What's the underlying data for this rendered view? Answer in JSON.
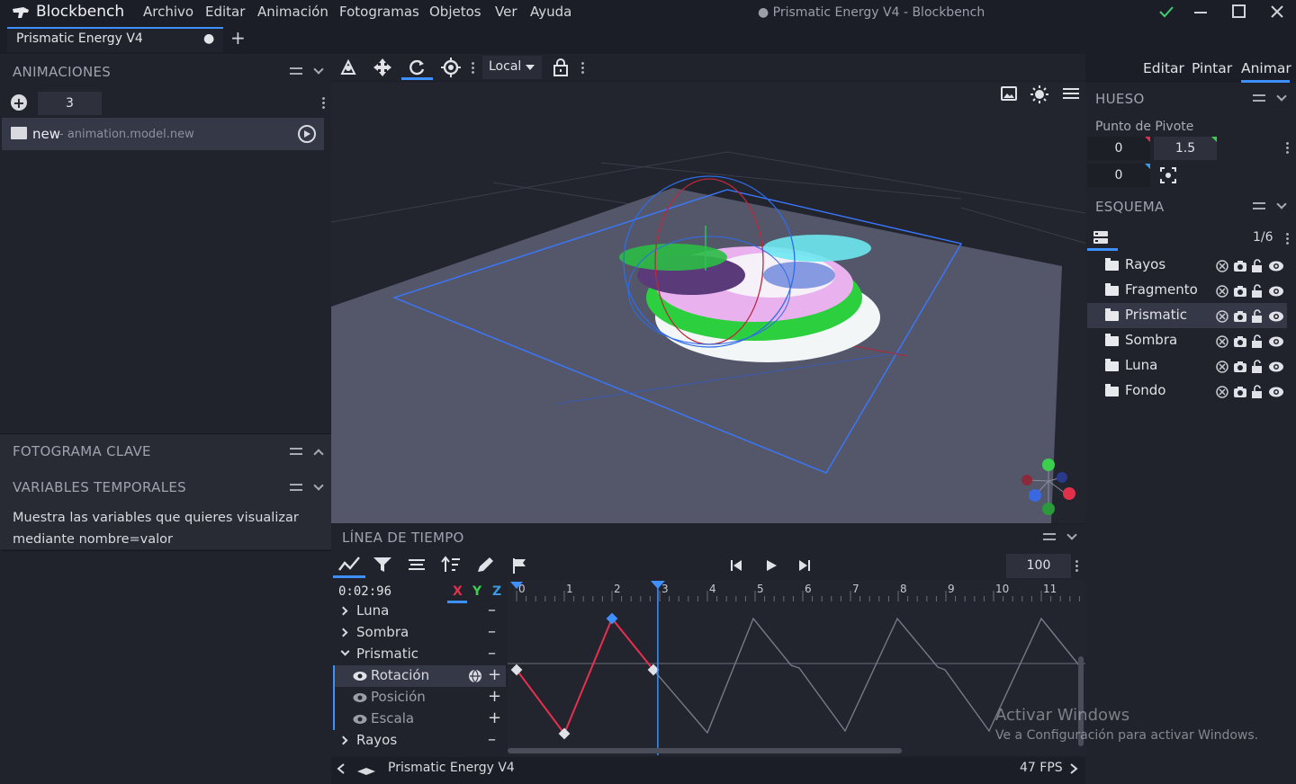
{
  "app": {
    "logo": "Blockbench",
    "window_title": "● Prismatic Energy V4 - Blockbench",
    "menu": [
      "Archivo",
      "Editar",
      "Animación",
      "Fotogramas",
      "Objetos",
      "Ver",
      "Ayuda"
    ],
    "window_controls": [
      "check-icon",
      "minimize-icon",
      "maximize-icon",
      "close-icon"
    ]
  },
  "tabs": [
    {
      "label": "Prismatic Energy V4",
      "modified": "●"
    }
  ],
  "tab_add": "+",
  "toolbar": {
    "space": "Local",
    "icons": [
      "move-pivot-icon",
      "move-icon",
      "rotate-icon",
      "pivot-icon",
      "lock-icon"
    ]
  },
  "modes": [
    "Editar",
    "Pintar",
    "Animar"
  ],
  "active_mode": "Animar",
  "animations": {
    "title": "ANIMACIONES",
    "count": "3",
    "items": [
      {
        "name": "new",
        "path": " - animation.model.new"
      }
    ]
  },
  "keyframe": {
    "title": "FOTOGRAMA CLAVE"
  },
  "variables": {
    "title": "VARIABLES TEMPORALES",
    "placeholder": "Muestra las variables que quieres visualizar mediante nombre=valor"
  },
  "bone": {
    "title": "HUESO",
    "pivot_label": "Punto de Pivote",
    "pivot": [
      "0",
      "1.5",
      "0"
    ]
  },
  "outliner": {
    "title": "ESQUEMA",
    "count": "1/6",
    "items": [
      {
        "name": "Rayos",
        "selected": false
      },
      {
        "name": "Fragmento",
        "selected": false
      },
      {
        "name": "Prismatic",
        "selected": true
      },
      {
        "name": "Sombra",
        "selected": false
      },
      {
        "name": "Luna",
        "selected": false
      },
      {
        "name": "Fondo",
        "selected": false
      }
    ]
  },
  "timeline": {
    "title": "LÍNEA DE TIEMPO",
    "time": "0:02:96",
    "axes": [
      "X",
      "Y",
      "Z"
    ],
    "zoom": "100",
    "ticks": [
      "0",
      "1",
      "2",
      "3",
      "4",
      "5",
      "6",
      "7",
      "8",
      "9",
      "10",
      "11"
    ],
    "rows": [
      {
        "label": "Luna",
        "type": "group",
        "action": "–"
      },
      {
        "label": "Sombra",
        "type": "group",
        "action": "–"
      },
      {
        "label": "Prismatic",
        "type": "group-open",
        "action": "–"
      },
      {
        "label": "Rotación",
        "type": "channel",
        "action": "+",
        "selected": true
      },
      {
        "label": "Posición",
        "type": "channel",
        "action": "+"
      },
      {
        "label": "Escala",
        "type": "channel",
        "action": "+"
      },
      {
        "label": "Rayos",
        "type": "group",
        "action": "–"
      }
    ],
    "playhead_seconds": 2.96
  },
  "status": {
    "model": "Prismatic Energy V4",
    "fps": "47 FPS"
  },
  "watermark": {
    "title": "Activar Windows",
    "subtitle": "Ve a Configuración para activar Windows."
  },
  "colors": {
    "accent": "#3e90ff",
    "bg": "#1c1e27",
    "panel": "#21232c",
    "selected": "#343847",
    "viewport": "#22242e"
  }
}
